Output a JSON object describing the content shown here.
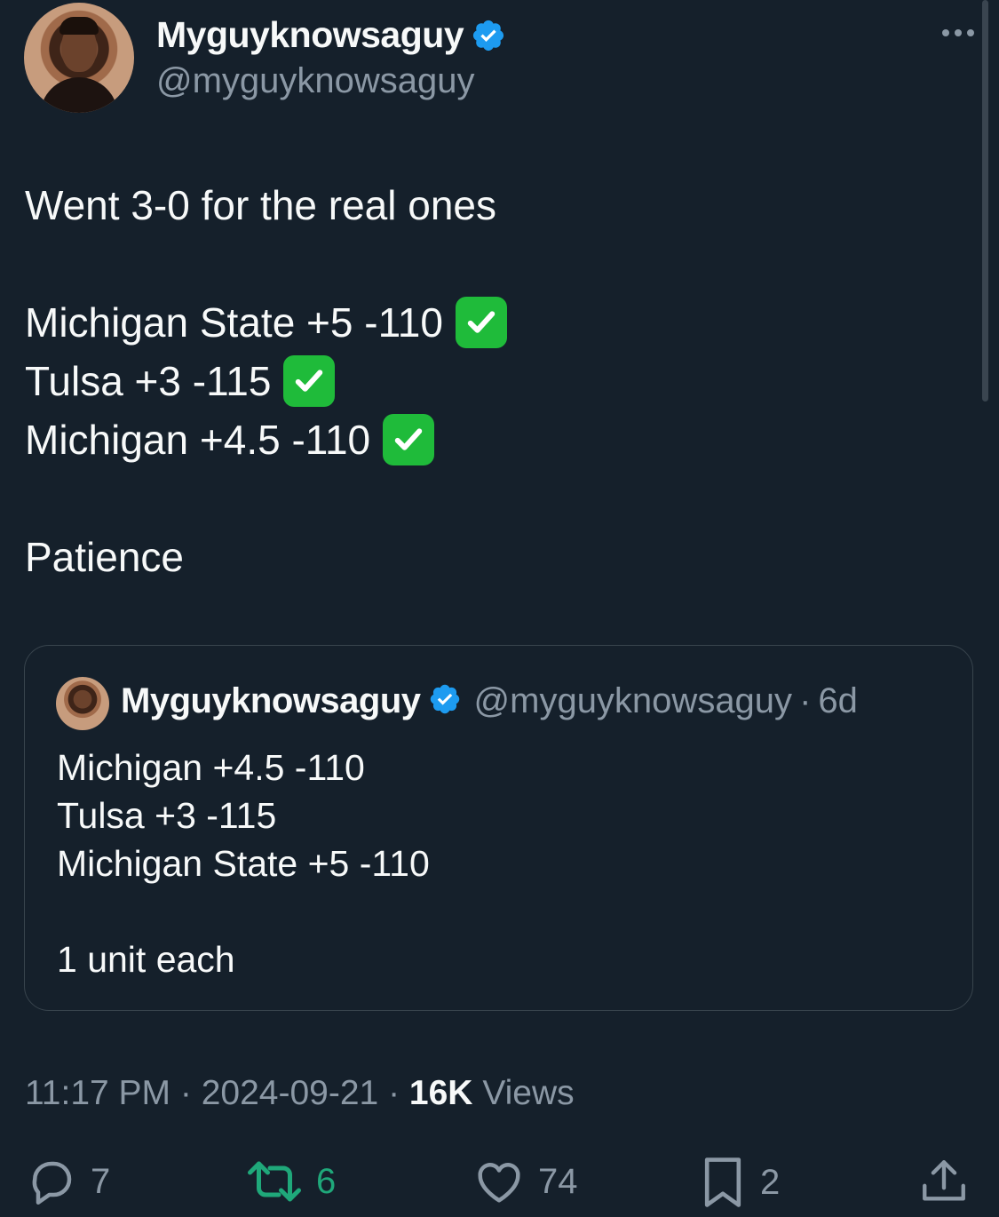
{
  "tweet": {
    "author_name": "Myguyknowsaguy",
    "author_handle": "@myguyknowsaguy",
    "lines": [
      "Went 3-0 for the real ones",
      "",
      "Michigan State +5 -110",
      "Tulsa +3 -115",
      "Michigan +4.5 -110",
      "",
      "Patience"
    ],
    "check_emoji": "✅"
  },
  "quoted": {
    "author_name": "Myguyknowsaguy",
    "author_handle": "@myguyknowsaguy",
    "separator": "·",
    "age": "6d",
    "lines": [
      "Michigan +4.5 -110",
      "Tulsa +3 -115",
      "Michigan State +5 -110",
      "",
      "1 unit each"
    ]
  },
  "meta": {
    "time": "11:17 PM",
    "date": "2024-09-21",
    "separator": "·",
    "views_count": "16K",
    "views_label": "Views"
  },
  "actions": {
    "replies": "7",
    "retweets": "6",
    "likes": "74",
    "bookmarks": "2"
  },
  "colors": {
    "background": "#15202b",
    "verified": "#1d9bf0",
    "muted": "#8b98a5",
    "retweet_active": "#1fa87a",
    "check_green": "#1fbb3a"
  },
  "icons": [
    "verified-badge-icon",
    "more-icon",
    "check-mark-icon",
    "reply-icon",
    "retweet-icon",
    "like-icon",
    "bookmark-icon",
    "share-icon"
  ]
}
